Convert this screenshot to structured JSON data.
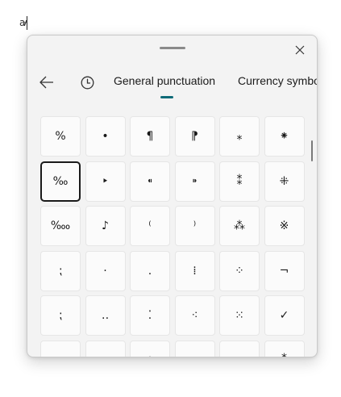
{
  "document": {
    "glyph": "ꜻ"
  },
  "picker": {
    "close_icon": "close-icon",
    "back_icon": "back-arrow-icon",
    "recent_icon": "clock-icon",
    "tabs": [
      {
        "label": "General punctuation",
        "active": true
      },
      {
        "label": "Currency symbo",
        "active": false
      }
    ],
    "accent_color": "#0f6b78",
    "symbols": [
      [
        "%",
        "•",
        "¶",
        "⁋",
        "⁎",
        "⁕"
      ],
      [
        "‰",
        "‣",
        "⁌",
        "⁍",
        "⁑",
        "⁜"
      ],
      [
        "‱",
        "♪",
        "⁽",
        "⁾",
        "⁂",
        "※"
      ],
      [
        "⁏",
        "·",
        ".",
        "⁞",
        "⁘",
        "¬"
      ],
      [
        "⁏",
        "‥",
        "⁚",
        "⁖",
        "⁙",
        "✓"
      ],
      [
        "",
        "",
        "⁝",
        "",
        "",
        "⁑"
      ]
    ],
    "selected": {
      "row": 1,
      "col": 0
    }
  }
}
